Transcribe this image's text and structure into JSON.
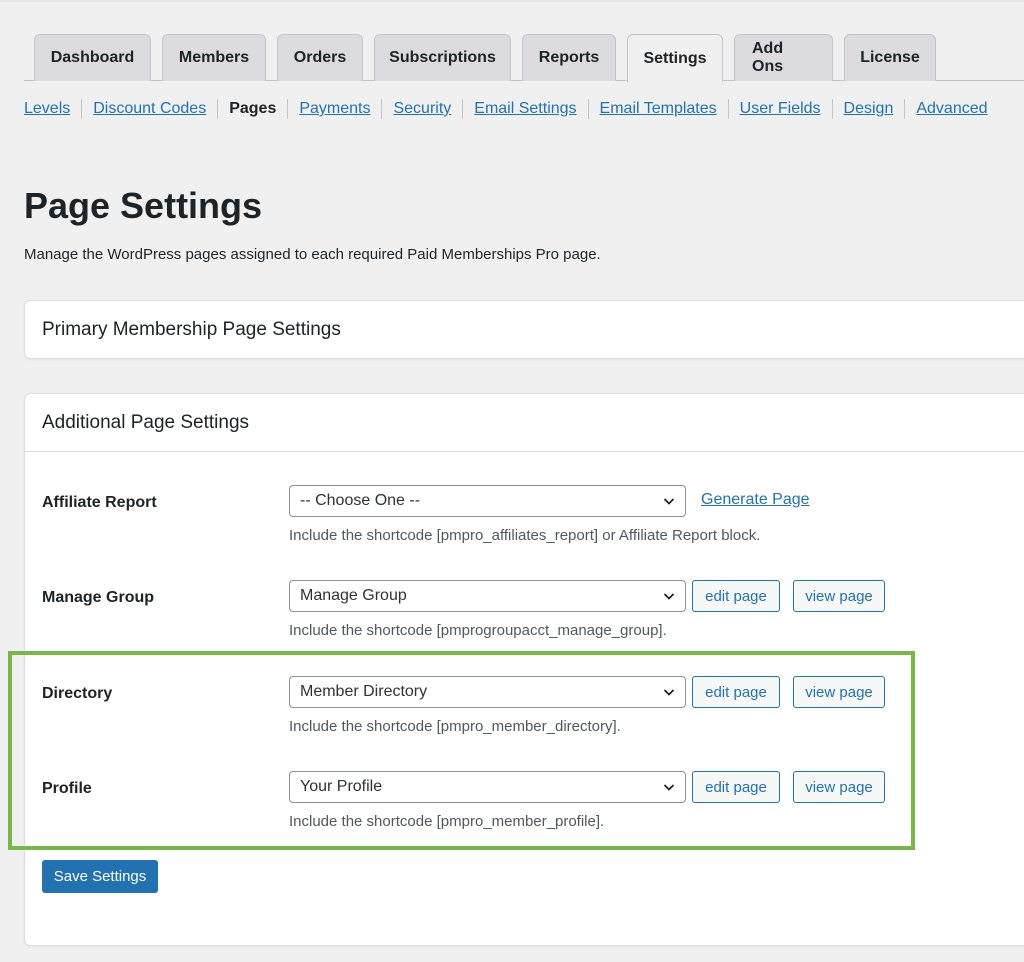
{
  "tabs": [
    {
      "label": "Dashboard",
      "active": false
    },
    {
      "label": "Members",
      "active": false
    },
    {
      "label": "Orders",
      "active": false
    },
    {
      "label": "Subscriptions",
      "active": false
    },
    {
      "label": "Reports",
      "active": false
    },
    {
      "label": "Settings",
      "active": true
    },
    {
      "label": "Add Ons",
      "active": false
    },
    {
      "label": "License",
      "active": false
    }
  ],
  "subnav": [
    {
      "label": "Levels",
      "current": false
    },
    {
      "label": "Discount Codes",
      "current": false
    },
    {
      "label": "Pages",
      "current": true
    },
    {
      "label": "Payments",
      "current": false
    },
    {
      "label": "Security",
      "current": false
    },
    {
      "label": "Email Settings",
      "current": false
    },
    {
      "label": "Email Templates",
      "current": false
    },
    {
      "label": "User Fields",
      "current": false
    },
    {
      "label": "Design",
      "current": false
    },
    {
      "label": "Advanced",
      "current": false
    }
  ],
  "page": {
    "title": "Page Settings",
    "description": "Manage the WordPress pages assigned to each required Paid Memberships Pro page."
  },
  "primary_panel": {
    "title": "Primary Membership Page Settings"
  },
  "additional_panel": {
    "title": "Additional Page Settings",
    "rows": [
      {
        "label": "Affiliate Report",
        "selected": "-- Choose One --",
        "link": "Generate Page",
        "description": "Include the shortcode [pmpro_affiliates_report] or Affiliate Report block."
      },
      {
        "label": "Manage Group",
        "selected": "Manage Group",
        "edit_label": "edit page",
        "view_label": "view page",
        "description": "Include the shortcode [pmprogroupacct_manage_group]."
      },
      {
        "label": "Directory",
        "selected": "Member Directory",
        "edit_label": "edit page",
        "view_label": "view page",
        "description": "Include the shortcode [pmpro_member_directory]."
      },
      {
        "label": "Profile",
        "selected": "Your Profile",
        "edit_label": "edit page",
        "view_label": "view page",
        "description": "Include the shortcode [pmpro_member_profile]."
      }
    ],
    "save_label": "Save Settings"
  },
  "colors": {
    "link": "#2271b1",
    "primary_button": "#2271b1",
    "highlight": "#7ab648",
    "background": "#f0f0f1"
  },
  "icons": {
    "select_caret": "chevron-down-icon"
  }
}
